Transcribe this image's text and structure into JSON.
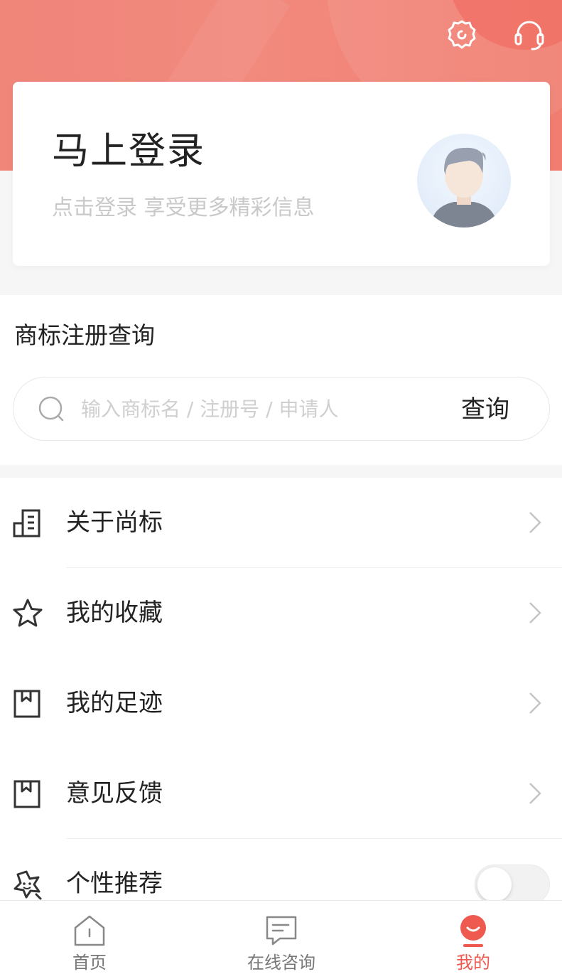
{
  "header": {
    "settings_icon": "gear-icon",
    "service_icon": "headset-icon"
  },
  "login": {
    "title": "马上登录",
    "subtitle": "点击登录 享受更多精彩信息"
  },
  "trademark_search": {
    "title": "商标注册查询",
    "placeholder": "输入商标名 / 注册号 / 申请人",
    "value": "",
    "button_label": "查询"
  },
  "menu": {
    "items": [
      {
        "label": "关于尚标",
        "icon": "building-icon"
      },
      {
        "label": "我的收藏",
        "icon": "star-icon"
      },
      {
        "label": "我的足迹",
        "icon": "bookmark-icon"
      },
      {
        "label": "意见反馈",
        "icon": "bookmark-icon"
      },
      {
        "label": "个性推荐",
        "icon": "sparkle-star-icon",
        "toggle_on": false
      }
    ]
  },
  "tabbar": {
    "tabs": [
      {
        "label": "首页",
        "icon": "home-icon",
        "active": false
      },
      {
        "label": "在线咨询",
        "icon": "chat-icon",
        "active": false
      },
      {
        "label": "我的",
        "icon": "smile-icon",
        "active": true
      }
    ]
  },
  "colors": {
    "brand": "#ee5a4f",
    "header_gradient": "#f0857a"
  }
}
